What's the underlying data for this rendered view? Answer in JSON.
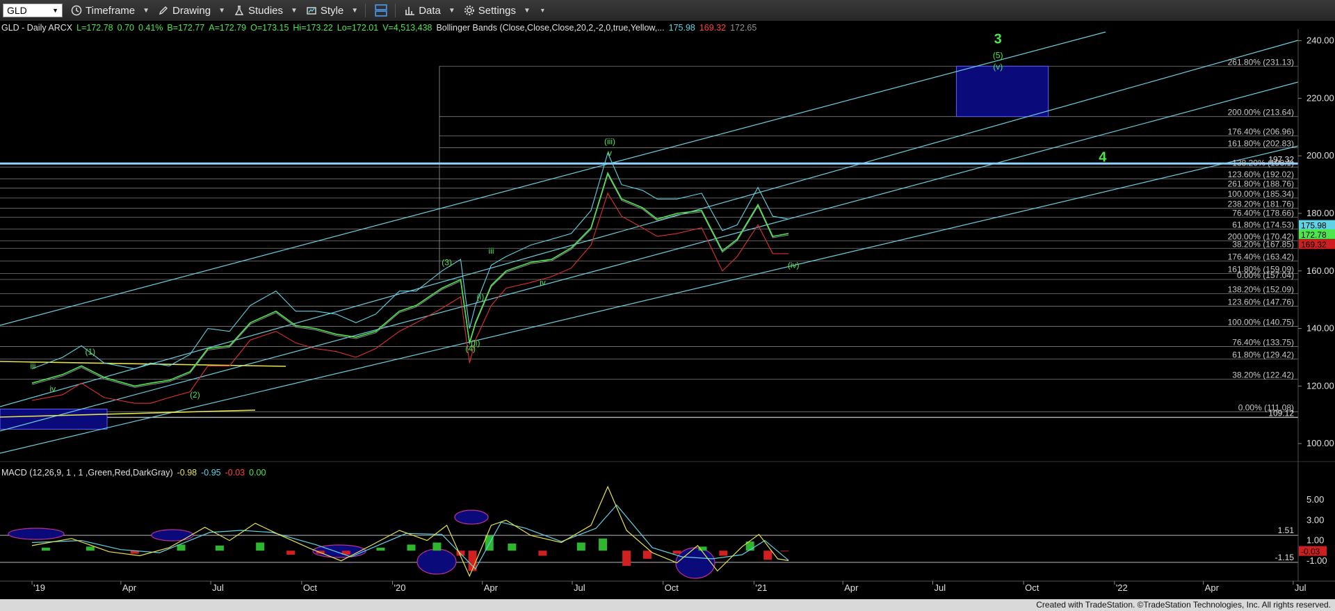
{
  "toolbar": {
    "symbol": "GLD",
    "timeframe": "Timeframe",
    "drawing": "Drawing",
    "studies": "Studies",
    "style": "Style",
    "data": "Data",
    "settings": "Settings"
  },
  "header": {
    "title": "GLD - Daily  ARCX",
    "quote": [
      {
        "text": "L=172.78",
        "color": "#4de64d"
      },
      {
        "text": "0.70",
        "color": "#4de64d"
      },
      {
        "text": "0.41%",
        "color": "#4de64d"
      },
      {
        "text": "B=172.77",
        "color": "#4de64d"
      },
      {
        "text": "A=172.79",
        "color": "#4de64d"
      },
      {
        "text": "O=173.15",
        "color": "#4de64d"
      },
      {
        "text": "Hi=173.22",
        "color": "#4de64d"
      },
      {
        "text": "Lo=172.01",
        "color": "#4de64d"
      },
      {
        "text": "V=4,513,438",
        "color": "#4de64d"
      },
      {
        "text": "Bollinger Bands (Close,Close,Close,20,2,-2,0,true,Yellow,...",
        "color": "#e0e0e0"
      },
      {
        "text": "175.98",
        "color": "#5fd3e6"
      },
      {
        "text": "169.32",
        "color": "#ff4040"
      },
      {
        "text": "172.65",
        "color": "#909090"
      }
    ]
  },
  "macd_header": [
    {
      "text": "MACD (12,26,9, 1 , 1 ,Green,Red,DarkGray)",
      "color": "#e0e0e0"
    },
    {
      "text": "-0.98",
      "color": "#e6e34d"
    },
    {
      "text": "-0.95",
      "color": "#5fd3e6"
    },
    {
      "text": "-0.03",
      "color": "#ff4040"
    },
    {
      "text": "0.00",
      "color": "#4de64d"
    }
  ],
  "footer": "Created with TradeStation. ©TradeStation Technologies, Inc. All rights reserved.",
  "colors": {
    "price": "#4de64d",
    "upper_band": "#5fd3e6",
    "lower_band": "#e03030",
    "mid_band": "#909090",
    "channel": "#6ad0e0",
    "fib": "#9a9a9a",
    "wave_label": "#4de64d",
    "target_box": "#0a0a7a"
  },
  "chart_data": {
    "type": "line",
    "title": "GLD - Daily",
    "x_axis": {
      "ticks": [
        "'19",
        "Apr",
        "Jul",
        "Oct",
        "'20",
        "Apr",
        "Jul",
        "Oct",
        "'21",
        "Apr",
        "Jul",
        "Oct",
        "'22",
        "Apr",
        "Jul"
      ],
      "tick_dates": [
        "2019-01-01",
        "2019-04-01",
        "2019-07-01",
        "2019-10-01",
        "2020-01-01",
        "2020-04-01",
        "2020-07-01",
        "2020-10-01",
        "2021-01-01",
        "2021-04-01",
        "2021-07-01",
        "2021-10-01",
        "2022-01-01",
        "2022-04-01",
        "2022-07-01"
      ]
    },
    "price_axis": {
      "ticks": [
        100,
        120,
        140,
        160,
        180,
        200,
        220,
        240
      ],
      "ylim": [
        94,
        244
      ]
    },
    "price_series": {
      "name": "GLD",
      "x": [
        "2019-01-01",
        "2019-02-01",
        "2019-02-20",
        "2019-03-15",
        "2019-04-15",
        "2019-05-01",
        "2019-05-20",
        "2019-06-10",
        "2019-06-28",
        "2019-07-20",
        "2019-08-10",
        "2019-09-05",
        "2019-09-25",
        "2019-10-15",
        "2019-11-05",
        "2019-11-25",
        "2019-12-15",
        "2020-01-08",
        "2020-01-25",
        "2020-02-20",
        "2020-03-10",
        "2020-03-19",
        "2020-03-25",
        "2020-04-10",
        "2020-04-25",
        "2020-05-20",
        "2020-06-10",
        "2020-06-30",
        "2020-07-20",
        "2020-08-06",
        "2020-08-20",
        "2020-09-10",
        "2020-09-25",
        "2020-10-15",
        "2020-11-09",
        "2020-11-30",
        "2020-12-15",
        "2021-01-05",
        "2021-01-20",
        "2021-02-05"
      ],
      "values": [
        121,
        124,
        127,
        123,
        120,
        121,
        122,
        125,
        133,
        134,
        142,
        146,
        141,
        140,
        138,
        137,
        139,
        146,
        148,
        154,
        157,
        135,
        142,
        155,
        160,
        163,
        164,
        168,
        175,
        194,
        185,
        182,
        178,
        180,
        181,
        167,
        171,
        183,
        172,
        173
      ]
    },
    "bollinger": {
      "upper_last": 175.98,
      "lower_last": 169.32,
      "mid_last": 172.65
    },
    "fib_levels": [
      {
        "label": "261.80% (231.13)",
        "value": 231.13
      },
      {
        "label": "200.00% (213.64)",
        "value": 213.64
      },
      {
        "label": "176.40% (206.96)",
        "value": 206.96
      },
      {
        "label": "161.80% (202.83)",
        "value": 202.83
      },
      {
        "label": "138.20% (196.1)",
        "value": 196.1
      },
      {
        "label": "123.60% (192.02)",
        "value": 192.02
      },
      {
        "label": "261.80% (188.76)",
        "value": 188.76
      },
      {
        "label": "100.00% (185.34)",
        "value": 185.34
      },
      {
        "label": "238.20% (181.76)",
        "value": 181.76
      },
      {
        "label": "76.40% (178.66)",
        "value": 178.66
      },
      {
        "label": "61.80% (174.53)",
        "value": 174.53
      },
      {
        "label": "200.00% (170.42)",
        "value": 170.42
      },
      {
        "label": "38.20% (167.85)",
        "value": 167.85
      },
      {
        "label": "176.40% (163.42)",
        "value": 163.42
      },
      {
        "label": "161.80% (159.09)",
        "value": 159.09
      },
      {
        "label": "0.00% (157.04)",
        "value": 157.04
      },
      {
        "label": "138.20% (152.09)",
        "value": 152.09
      },
      {
        "label": "123.60% (147.76)",
        "value": 147.76
      },
      {
        "label": "100.00% (140.75)",
        "value": 140.75
      },
      {
        "label": "76.40% (133.75)",
        "value": 133.75
      },
      {
        "label": "61.80% (129.42)",
        "value": 129.42
      },
      {
        "label": "38.20% (122.42)",
        "value": 122.42
      },
      {
        "label": "0.00% (111.08)",
        "value": 111.08
      }
    ],
    "horizontal_lines": [
      {
        "label": "197.32",
        "value": 197.32
      },
      {
        "label": "109.12",
        "value": 109.12
      }
    ],
    "price_tags": [
      {
        "label": "175.98",
        "value": 175.98,
        "color": "#5fd3e6"
      },
      {
        "label": "172.78",
        "value": 172.78,
        "color": "#4de64d"
      },
      {
        "label": "169.32",
        "value": 169.32,
        "color": "#cc2020"
      }
    ],
    "wave_labels": [
      {
        "text": "3",
        "x": "2021-09-05",
        "y": 239,
        "big": true
      },
      {
        "text": "(5)",
        "x": "2021-09-05",
        "y": 234
      },
      {
        "text": "(v)",
        "x": "2021-09-05",
        "y": 230
      },
      {
        "text": "4",
        "x": "2021-12-20",
        "y": 198,
        "big": true
      },
      {
        "text": "(iii)",
        "x": "2020-08-08",
        "y": 204
      },
      {
        "text": "v",
        "x": "2020-08-08",
        "y": 200
      },
      {
        "text": "(iv)",
        "x": "2021-02-10",
        "y": 161
      },
      {
        "text": "iii",
        "x": "2020-04-10",
        "y": 166
      },
      {
        "text": "iv",
        "x": "2020-06-01",
        "y": 155
      },
      {
        "text": "(3)",
        "x": "2020-02-25",
        "y": 162
      },
      {
        "text": "(i)",
        "x": "2020-03-30",
        "y": 150
      },
      {
        "text": "(ii)",
        "x": "2020-03-25",
        "y": 134
      },
      {
        "text": "(4)",
        "x": "2020-03-20",
        "y": 132
      },
      {
        "text": "(1)",
        "x": "2019-03-01",
        "y": 131
      },
      {
        "text": "(2)",
        "x": "2019-06-15",
        "y": 116
      },
      {
        "text": "iii",
        "x": "2019-01-02",
        "y": 126
      },
      {
        "text": "iv",
        "x": "2019-01-22",
        "y": 118
      }
    ],
    "target_box": {
      "x_start": "2021-07-25",
      "x_end": "2021-10-26",
      "y_low": 213.64,
      "y_high": 231.13
    },
    "macd": {
      "axis_ticks": [
        5.0,
        3.0,
        1.0,
        -1.0
      ],
      "ylim": [
        -3.0,
        7.0
      ],
      "levels": [
        {
          "label": "1.51",
          "value": 1.51
        },
        {
          "label": "-1.15",
          "value": -1.15
        }
      ],
      "last_tag": {
        "label": "-0.03",
        "value": -0.03
      },
      "macd_line": {
        "x": [
          "2019-01-01",
          "2019-02-10",
          "2019-03-20",
          "2019-04-20",
          "2019-05-20",
          "2019-06-25",
          "2019-07-20",
          "2019-08-15",
          "2019-09-10",
          "2019-10-10",
          "2019-11-10",
          "2019-12-10",
          "2020-01-08",
          "2020-02-05",
          "2020-02-25",
          "2020-03-19",
          "2020-04-10",
          "2020-04-25",
          "2020-05-20",
          "2020-06-20",
          "2020-07-20",
          "2020-08-06",
          "2020-08-25",
          "2020-09-20",
          "2020-10-15",
          "2020-11-05",
          "2020-11-25",
          "2020-12-20",
          "2021-01-06",
          "2021-01-25",
          "2021-02-05"
        ],
        "values": [
          0.5,
          1.2,
          -0.1,
          -0.5,
          0.3,
          2.3,
          1.0,
          2.7,
          1.5,
          0.2,
          -1.0,
          0.5,
          2.0,
          1.0,
          2.5,
          -2.5,
          2.5,
          3.0,
          1.5,
          0.8,
          2.5,
          6.3,
          2.0,
          -0.2,
          -1.2,
          0.5,
          -2.0,
          0.4,
          1.6,
          -0.8,
          -0.98
        ]
      },
      "signal_line": {
        "x": [
          "2019-01-01",
          "2019-02-20",
          "2019-04-01",
          "2019-05-10",
          "2019-06-30",
          "2019-08-01",
          "2019-09-01",
          "2019-10-15",
          "2019-11-20",
          "2020-01-15",
          "2020-02-20",
          "2020-03-25",
          "2020-04-20",
          "2020-05-15",
          "2020-06-20",
          "2020-07-25",
          "2020-08-15",
          "2020-09-20",
          "2020-10-20",
          "2020-11-20",
          "2020-12-20",
          "2021-01-12",
          "2021-02-05"
        ],
        "values": [
          0.8,
          1.0,
          0.1,
          -0.2,
          1.8,
          2.0,
          1.8,
          0.6,
          -0.6,
          1.7,
          1.6,
          -1.8,
          2.8,
          2.2,
          0.9,
          2.2,
          4.5,
          0.3,
          -0.6,
          -0.8,
          -0.4,
          1.0,
          -0.95
        ]
      },
      "histogram": {
        "x": [
          "2019-01-15",
          "2019-03-01",
          "2019-04-15",
          "2019-06-01",
          "2019-07-10",
          "2019-08-20",
          "2019-09-20",
          "2019-10-20",
          "2019-11-15",
          "2019-12-20",
          "2020-01-20",
          "2020-02-15",
          "2020-03-10",
          "2020-03-22",
          "2020-04-08",
          "2020-05-01",
          "2020-06-01",
          "2020-07-10",
          "2020-08-01",
          "2020-08-25",
          "2020-09-15",
          "2020-10-15",
          "2020-11-10",
          "2020-12-01",
          "2020-12-28",
          "2021-01-15",
          "2021-02-01"
        ],
        "values": [
          0.3,
          0.4,
          -0.3,
          0.6,
          0.5,
          0.8,
          -0.4,
          -0.3,
          -0.4,
          0.3,
          0.6,
          0.8,
          -0.5,
          -2.0,
          1.5,
          0.7,
          -0.5,
          0.8,
          1.2,
          -1.5,
          -0.8,
          -0.3,
          0.4,
          -0.5,
          0.9,
          -0.9,
          -0.03
        ]
      }
    }
  }
}
